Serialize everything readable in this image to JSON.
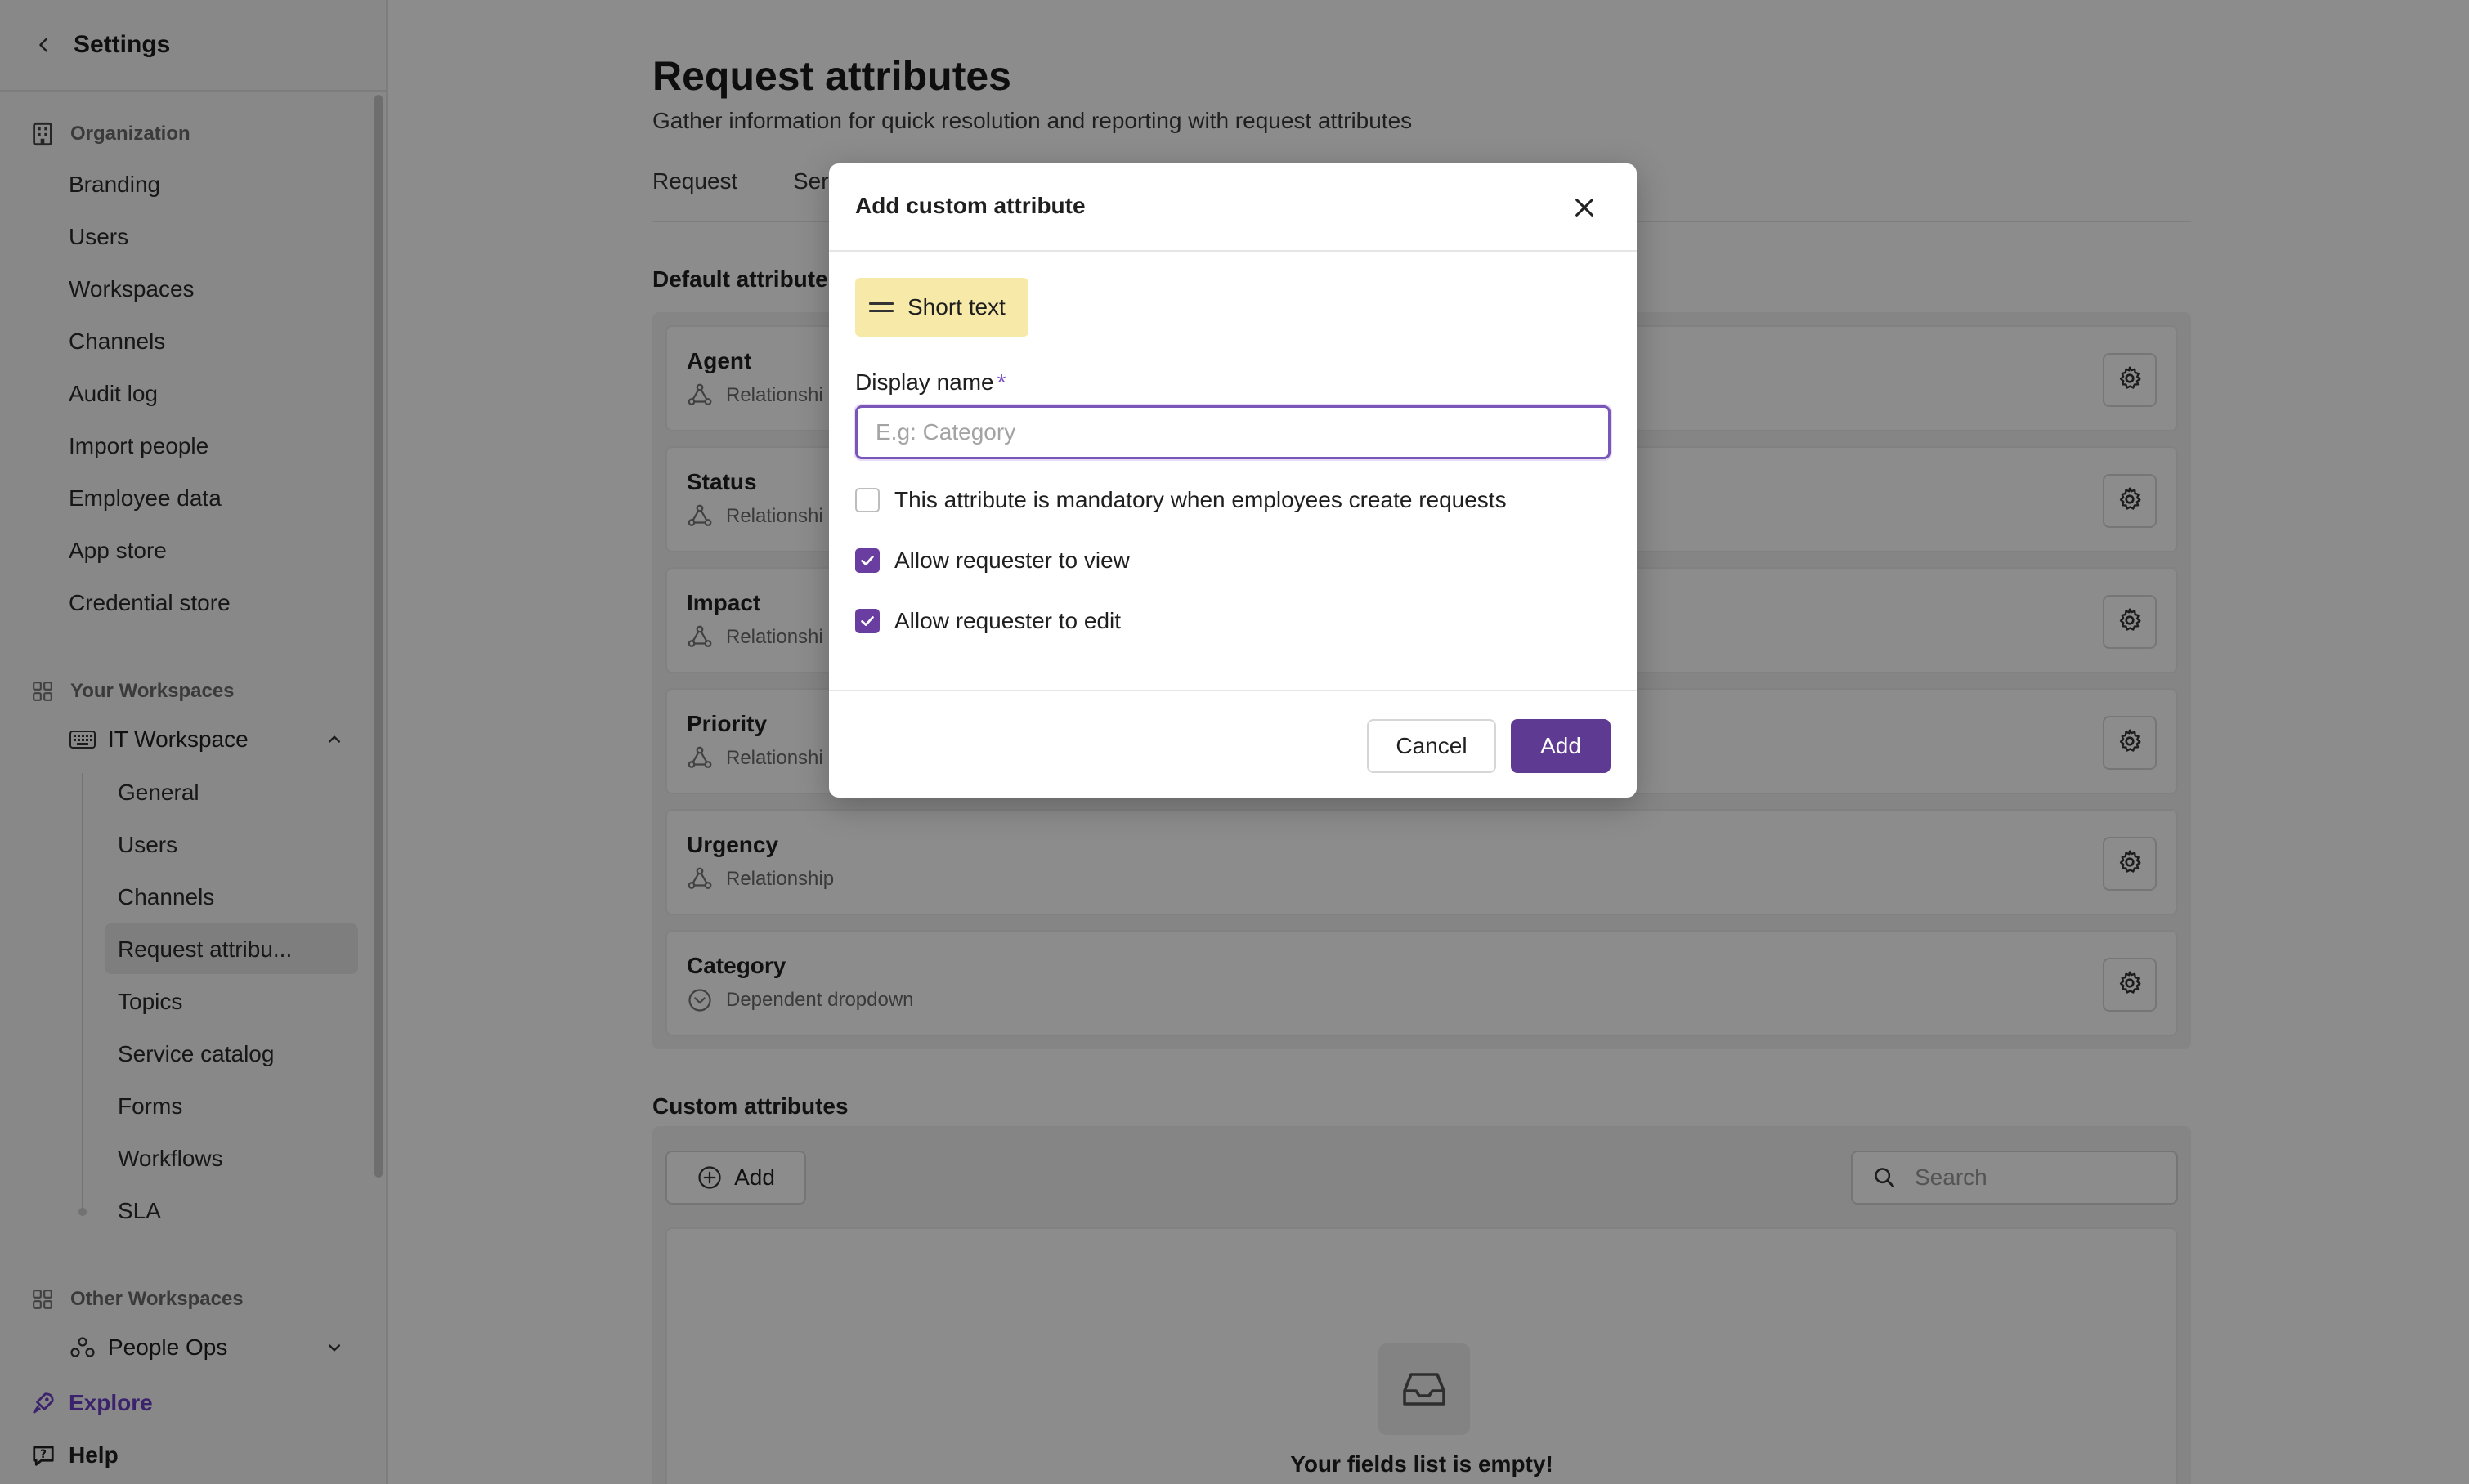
{
  "sidebar": {
    "title": "Settings",
    "organization": {
      "heading": "Organization",
      "items": [
        "Branding",
        "Users",
        "Workspaces",
        "Channels",
        "Audit log",
        "Import people",
        "Employee data",
        "App store",
        "Credential store"
      ]
    },
    "your_workspaces": {
      "heading": "Your Workspaces",
      "workspace": "IT Workspace",
      "items": [
        "General",
        "Users",
        "Channels",
        "Request attribu...",
        "Topics",
        "Service catalog",
        "Forms",
        "Workflows",
        "SLA"
      ],
      "active_item": "Request attribu..."
    },
    "other_workspaces": {
      "heading": "Other Workspaces",
      "workspace": "People Ops"
    },
    "explore": "Explore",
    "help": "Help"
  },
  "main": {
    "title": "Request attributes",
    "subtitle": "Gather information for quick resolution and reporting with request attributes",
    "tabs": [
      "Request",
      "Ser"
    ],
    "default_section": "Default attribute",
    "default_attributes": [
      {
        "name": "Agent",
        "type": "Relationshi"
      },
      {
        "name": "Status",
        "type": "Relationshi"
      },
      {
        "name": "Impact",
        "type": "Relationshi"
      },
      {
        "name": "Priority",
        "type": "Relationshi"
      },
      {
        "name": "Urgency",
        "type": "Relationship"
      },
      {
        "name": "Category",
        "type": "Dependent dropdown"
      }
    ],
    "custom_section": "Custom attributes",
    "add_label": "Add",
    "search_placeholder": "Search",
    "empty_text": "Your fields list is empty!"
  },
  "modal": {
    "title": "Add custom attribute",
    "type_chip": "Short text",
    "field_label": "Display name",
    "required_mark": "*",
    "input_placeholder": "E.g: Category",
    "input_value": "",
    "checkboxes": [
      {
        "label": "This attribute is mandatory when employees create requests",
        "checked": false
      },
      {
        "label": "Allow requester to view",
        "checked": true
      },
      {
        "label": "Allow requester to edit",
        "checked": true
      }
    ],
    "cancel_label": "Cancel",
    "add_label": "Add"
  },
  "colors": {
    "accent": "#5f3a93",
    "explore": "#6c3fc6",
    "chip": "#f7e9a8"
  }
}
